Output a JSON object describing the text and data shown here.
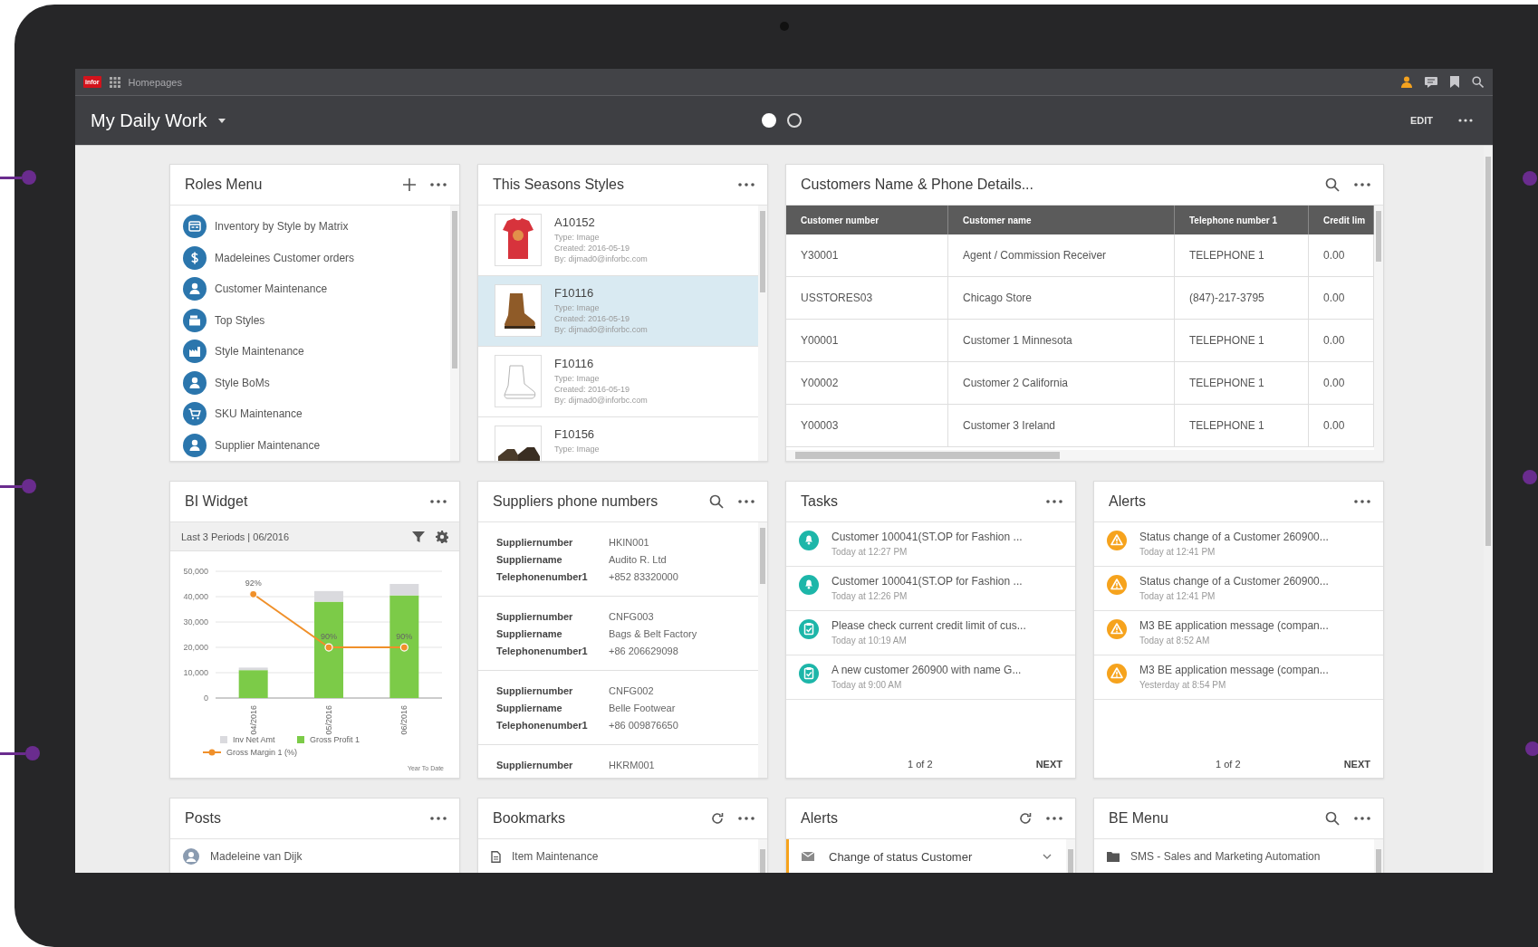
{
  "top_bar": {
    "logo": "infor",
    "breadcrumb": "Homepages"
  },
  "header": {
    "title": "My Daily Work",
    "pages": [
      {
        "selected": true
      },
      {
        "selected": false
      }
    ],
    "edit": "EDIT"
  },
  "roles_menu": {
    "title": "Roles Menu",
    "items": [
      {
        "kind": "matrix",
        "label": "Inventory by Style by Matrix"
      },
      {
        "kind": "dollar",
        "label": "Madeleines Customer orders"
      },
      {
        "kind": "person",
        "label": "Customer Maintenance"
      },
      {
        "kind": "stack",
        "label": "Top Styles"
      },
      {
        "kind": "factory",
        "label": "Style Maintenance"
      },
      {
        "kind": "person",
        "label": "Style BoMs"
      },
      {
        "kind": "cart",
        "label": "SKU Maintenance"
      },
      {
        "kind": "person",
        "label": "Supplier Maintenance"
      }
    ]
  },
  "season_styles": {
    "title": "This Seasons Styles",
    "items": [
      {
        "kind": "shirt",
        "selected": false,
        "code": "A10152",
        "type": "Type: Image",
        "created": "Created: 2016-05-19",
        "by": "By: dijmad0@inforbc.com"
      },
      {
        "kind": "boot",
        "selected": true,
        "code": "F10116",
        "type": "Type: Image",
        "created": "Created: 2016-05-19",
        "by": "By: dijmad0@inforbc.com"
      },
      {
        "kind": "sketch",
        "selected": false,
        "code": "F10116",
        "type": "Type: Image",
        "created": "Created: 2016-05-19",
        "by": "By: dijmad0@inforbc.com"
      },
      {
        "kind": "pair",
        "selected": false,
        "code": "F10156",
        "type": "Type: Image"
      }
    ]
  },
  "customers": {
    "title": "Customers Name & Phone Details...",
    "columns": [
      "Customer number",
      "Customer name",
      "Telephone number 1",
      "Credit lim"
    ],
    "rows": [
      [
        "Y30001",
        "Agent / Commission Receiver",
        "TELEPHONE 1",
        "0.00"
      ],
      [
        "USSTORES03",
        "Chicago Store",
        "(847)-217-3795",
        "0.00"
      ],
      [
        "Y00001",
        "Customer 1 Minnesota",
        "TELEPHONE 1",
        "0.00"
      ],
      [
        "Y00002",
        "Customer 2 California",
        "TELEPHONE 1",
        "0.00"
      ],
      [
        "Y00003",
        "Customer 3 Ireland",
        "TELEPHONE 1",
        "0.00"
      ]
    ]
  },
  "bi_widget": {
    "title": "BI Widget",
    "period": "Last 3 Periods | 06/2016",
    "footnote": "Year To Date",
    "chart_data": {
      "type": "bar",
      "stacked": true,
      "grid": true,
      "legend": "bottom",
      "categories": [
        "04/2016",
        "05/2016",
        "06/2016"
      ],
      "ylim": [
        0,
        50000
      ],
      "yticks": [
        {
          "value": 0,
          "label": "0"
        },
        {
          "value": 10000,
          "label": "10,000"
        },
        {
          "value": 20000,
          "label": "20,000"
        },
        {
          "value": 30000,
          "label": "30,000"
        },
        {
          "value": 40000,
          "label": "40,000"
        },
        {
          "value": 50000,
          "label": "50,000"
        }
      ],
      "series": [
        {
          "name": "Gross Profit 1",
          "color": "#7ccb48",
          "values": [
            11000,
            38000,
            40500
          ]
        },
        {
          "name": "Inv Net Amt",
          "color": "#dadade",
          "values": [
            1000,
            4200,
            4500
          ]
        }
      ]
    },
    "overlay": {
      "chart_data": {
        "type": "line",
        "legend": "bottom-left",
        "series": [
          {
            "name": "Gross Margin 1 (%)",
            "color": "#f0902a",
            "marker": true,
            "values": [
              92,
              90,
              90
            ],
            "value_labels": [
              "92%",
              "90%",
              "90%"
            ]
          }
        ]
      }
    }
  },
  "suppliers": {
    "title": "Suppliers phone numbers",
    "records": [
      {
        "fields": [
          {
            "label": "Suppliernumber",
            "value": "HKIN001"
          },
          {
            "label": "Suppliername",
            "value": "Audito R. Ltd"
          },
          {
            "label": "Telephonenumber1",
            "value": "+852 83320000"
          }
        ]
      },
      {
        "fields": [
          {
            "label": "Suppliernumber",
            "value": "CNFG003"
          },
          {
            "label": "Suppliername",
            "value": "Bags & Belt Factory"
          },
          {
            "label": "Telephonenumber1",
            "value": "+86 206629098"
          }
        ]
      },
      {
        "fields": [
          {
            "label": "Suppliernumber",
            "value": "CNFG002"
          },
          {
            "label": "Suppliername",
            "value": "Belle Footwear"
          },
          {
            "label": "Telephonenumber1",
            "value": "+86 009876650"
          }
        ]
      },
      {
        "fields": [
          {
            "label": "Suppliernumber",
            "value": "HKRM001"
          }
        ]
      }
    ]
  },
  "tasks": {
    "title": "Tasks",
    "items": [
      {
        "kind": "bell",
        "text": "Customer 100041(ST.OP for Fashion ...",
        "time": "Today at 12:27 PM"
      },
      {
        "kind": "bell",
        "text": "Customer 100041(ST.OP for Fashion ...",
        "time": "Today at 12:26 PM"
      },
      {
        "kind": "clipboard",
        "text": "Please check current credit limit of cus...",
        "time": "Today at 10:19 AM"
      },
      {
        "kind": "clipboard",
        "text": "A new customer 260900 with name G...",
        "time": "Today at 9:00 AM"
      }
    ],
    "pager": "1 of 2",
    "next": "NEXT"
  },
  "alerts": {
    "title": "Alerts",
    "items": [
      {
        "kind": "warning",
        "text": "Status change of a Customer 260900...",
        "time": "Today at 12:41 PM"
      },
      {
        "kind": "warning",
        "text": "Status change of a Customer 260900...",
        "time": "Today at 12:41 PM"
      },
      {
        "kind": "warning",
        "text": "M3 BE application message (compan...",
        "time": "Today at 8:52 AM"
      },
      {
        "kind": "warning",
        "text": "M3 BE application message (compan...",
        "time": "Yesterday at 8:54 PM"
      }
    ],
    "pager": "1 of 2",
    "next": "NEXT"
  },
  "bottom_row": [
    {
      "kind": "posts",
      "title": "Posts",
      "item": "Madeleine van Dijk"
    },
    {
      "kind": "bookmarks",
      "title": "Bookmarks",
      "item": "Item Maintenance"
    },
    {
      "kind": "alerts",
      "title": "Alerts",
      "item": "Change of status Customer"
    },
    {
      "kind": "menu",
      "title": "BE Menu",
      "item": "SMS - Sales and Marketing Automation"
    }
  ]
}
